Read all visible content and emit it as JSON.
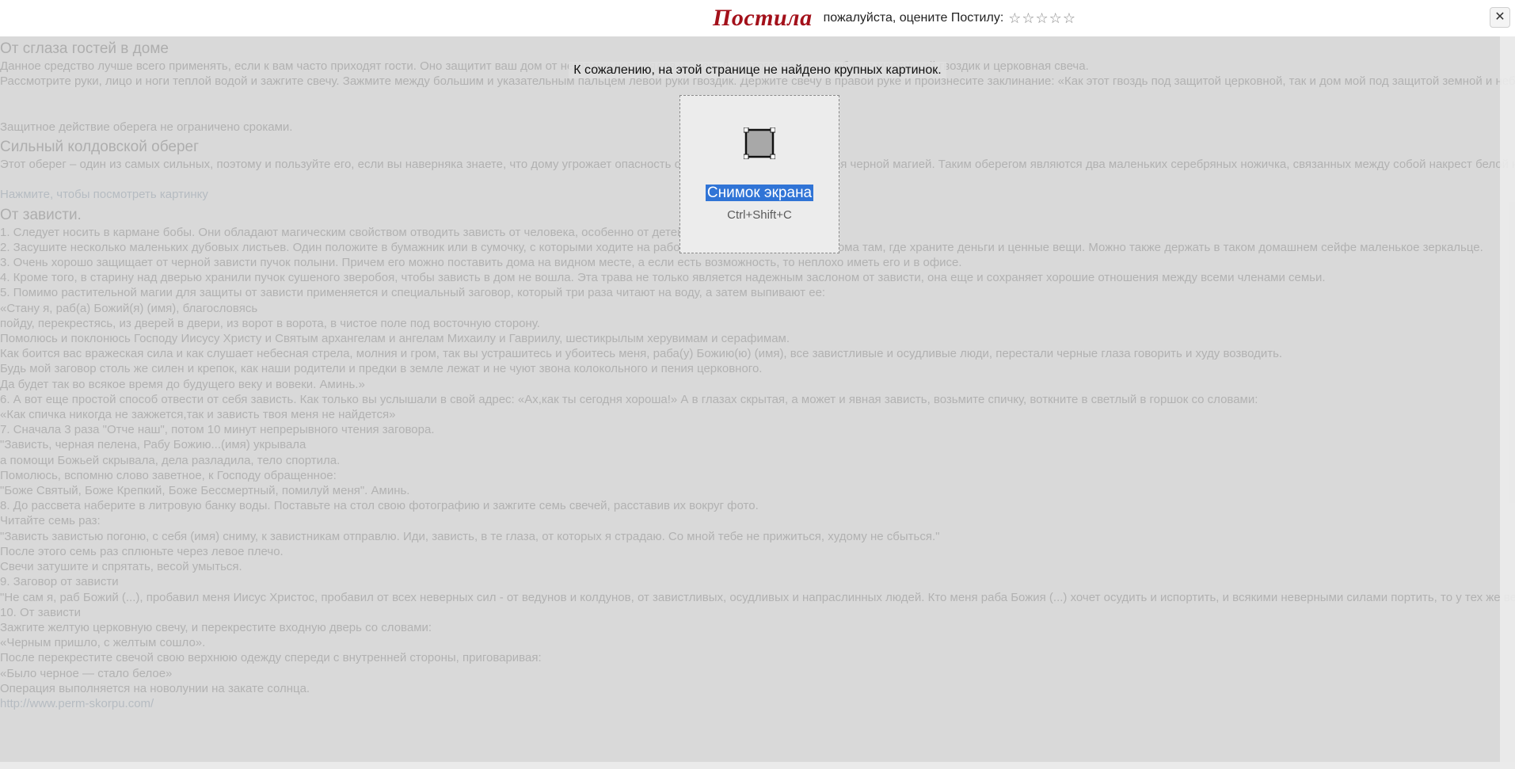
{
  "topbar": {
    "logo": "Постила",
    "prompt": "пожалуйста, оцените Постилу:",
    "stars": "☆☆☆☆☆",
    "close": "✕"
  },
  "notice": "К сожалению, на этой странице не найдено крупных картинок.",
  "card": {
    "label": "Снимок экрана",
    "shortcut": "Ctrl+Shift+C",
    "icon": "crop-icon"
  },
  "article": {
    "heading1": "От сглаза гостей в доме",
    "p1": [
      "Данное средство лучше всего применять, если к вам часто приходят гости. Оно защитит ваш дом от негативных взглядов и слов. Для этого вам понадобится маленький гвоздик и церковная свеча.",
      "Рассмотрите руки, лицо и ноги теплой водой и зажгите свечу. Зажмите между большим и указательным пальцем левой руки гвоздик. Держите свечу в правой руке и произнесите заклинание: «Как этот гвоздь под защитой церковной, так и дом мой под защитой земной и небесной. Как металл никто не видит, так и меня обидеть не могут. Да будет так. Аминь». Затем задуйте свечу и полностью воткните в нее гвоздь. Ваш оберег от сглаза готов. Храните его в любом месте дома по вашу усмотрению, но так, чтобы оберег никто не мог увидеть и при уборке случайно выбросить или передвинуть его с места на место.",
      "Защитное действие оберега не ограничено сроками."
    ],
    "heading2": "Сильный колдовской оберег",
    "p2": [
      "Этот оберег – один из самых сильных, поэтому и пользуйте его, если вы наверняка знаете, что дому угрожает опасность от людей, которые занимаются черной магией. Таким оберегом являются два маленьких серебряных ножичка, связанных между собой накрест белой ниткой. Их нужно повесить над входной дверью острием вниз, и тогда все злые чары черного мага рассыплются перед вашим домом.",
      "Нажмите, чтобы посмотреть картинку"
    ],
    "heading3": "От зависти.",
    "list": [
      "1. Следует носить в кармане бобы. Они обладают магическим свойством отводить зависть от человека, особенно от детей.",
      "2. Засушите несколько маленьких дубовых листьев. Один положите в бумажник или в сумочку, с которыми ходите на работу, а остальные разложите дома там, где храните деньги и ценные вещи. Можно также держать в таком домашнем сейфе маленькое зеркальце.",
      "3. Очень хорошо защищает от черной зависти пучок полыни. Причем его можно поставить дома на видном месте, а если есть возможность, то неплохо иметь его и в офисе.",
      "4. Кроме того, в старину над дверью хранили пучок сушеного зверобоя, чтобы зависть в дом не вошла. Эта трава не только является надежным заслоном от зависти, она еще и сохраняет хорошие отношения между всеми членами семьи.",
      "5. Помимо растительной магии для защиты от зависти применяется и специальный заговор, который три раза читают на воду, а затем выпивают ее:",
      "«Стану я, раб(а) Божий(я) (имя), благословясь",
      "пойду, перекрестясь, из дверей в двери, из ворот в ворота, в чистое поле под восточную сторону.",
      "Помолюсь и поклонюсь Господу Иисусу Христу и Святым архангелам и ангелам Михаилу и Гавриилу, шестикрылым херувимам и серафимам.",
      "Как боится вас вражеская сила и как слушает небесная стрела, молния и гром, так вы устрашитесь и убоитесь меня, раба(у) Божию(ю) (имя), все завистливые и осудливые люди, перестали черные глаза говорить и худу возводить.",
      "Будь мой заговор столь же силен и крепок, как наши родители и предки в земле лежат и не чуют звона колокольного и пения церковного.",
      "Да будет так во всякое время до будущего веку и вовеки. Аминь.»",
      "6. А вот еще простой способ отвести от себя зависть. Как только вы услышали в свой адрес: «Ах,как ты сегодня хороша!» А в глазах скрытая, а может и явная зависть, возьмите спичку, воткните в светлый в горшок со словами:",
      "«Как спичка никогда не зажжется,так и зависть твоя меня не найдется»",
      "7. Сначала 3 раза \"Отче наш\", потом 10 минут непрерывного чтения заговора.",
      "\"Зависть, черная пелена, Рабу Божию...(имя) укрывала",
      "а помощи Божьей скрывала, дела разладила, тело спортила.",
      "Помолюсь, вспомню слово заветное, к Господу обращенное:",
      "\"Боже Святый, Боже Крепкий, Боже Бессмертный, помилуй меня\". Аминь.",
      "8. До рассвета наберите в литровую банку воды. Поставьте на стол свою фотографию и зажгите семь свечей, расставив их вокруг фото.",
      "Читайте семь раз:",
      "\"Зависть завистью погоню, с себя (имя) сниму, к завистникам отправлю. Иди, зависть, в те глаза, от которых я страдаю. Со мной тебе не прижиться, худому не сбыться.\"",
      "После этого семь раз сплюньте через левое плечо.",
      "Свечи затушите и спрятать, весой умыться.",
      "9. Заговор от зависти",
      "\"Не сам я, раб Божий (...), пробавил меня Иисус Христос, пробавил от всех неверных сил - от ведунов и колдунов, от завистливых, осудливых и напраслинных людей. Кто меня раба Божия (...) хочет осудить и испортить, и всякими неверными силами портить, то у тех же ведунов и колдунов у завистливых, осудливых и напраслинных людей, ноги отпадут по колена, руки по локоть и голова по плечи, тогда меня раба Божьего (...) осуди и испорти, я же обещаю Христу поклоняться ему. Верую во единого Бога Отца и Сына и Святого Духа и ныне и присно и во веки веков. Аминь\"",
      "10. От зависти",
      "Зажгите желтую церковную свечу, и перекрестите входную дверь со словами:",
      "«Черным пришло, с желтым сошло».",
      "После перекрестите свечой свою верхнюю одежду спереди с внутренней стороны, приговаривая:",
      "«Было черное — стало белое»",
      "Операция выполняется на новолунии на закате солнца.",
      "http://www.perm-skorpu.com/"
    ]
  }
}
